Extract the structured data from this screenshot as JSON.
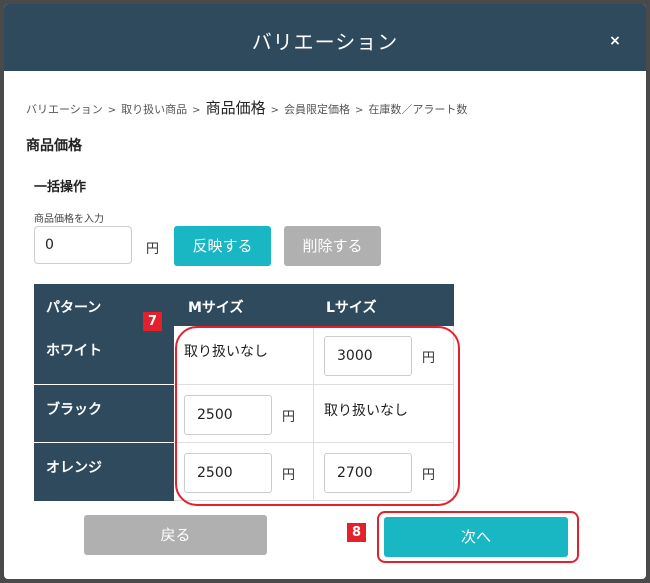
{
  "modal": {
    "title": "バリエーション",
    "close_label": "×"
  },
  "breadcrumb": {
    "items": [
      "バリエーション",
      "取り扱い商品",
      "商品価格",
      "会員限定価格",
      "在庫数／アラート数"
    ],
    "separator": ">",
    "current_index": 2
  },
  "section_title": "商品価格",
  "bulk": {
    "title": "一括操作",
    "input_label": "商品価格を入力",
    "input_value": "0",
    "currency": "円",
    "apply_label": "反映する",
    "delete_label": "削除する"
  },
  "table": {
    "headers": [
      "パターン",
      "Mサイズ",
      "Lサイズ"
    ],
    "rows": [
      {
        "pattern": "ホワイト",
        "m": {
          "type": "na",
          "text": "取り扱いなし"
        },
        "l": {
          "type": "input",
          "value": "3000",
          "currency": "円"
        }
      },
      {
        "pattern": "ブラック",
        "m": {
          "type": "input",
          "value": "2500",
          "currency": "円"
        },
        "l": {
          "type": "na",
          "text": "取り扱いなし"
        }
      },
      {
        "pattern": "オレンジ",
        "m": {
          "type": "input",
          "value": "2500",
          "currency": "円"
        },
        "l": {
          "type": "input",
          "value": "2700",
          "currency": "円"
        }
      }
    ]
  },
  "annotations": {
    "badge_7": "7",
    "badge_8": "8"
  },
  "footer": {
    "back_label": "戻る",
    "next_label": "次へ"
  },
  "colors": {
    "header_bg": "#2f4a5c",
    "primary": "#19b6c4",
    "disabled": "#b0b0b0",
    "highlight": "#e2212d"
  }
}
